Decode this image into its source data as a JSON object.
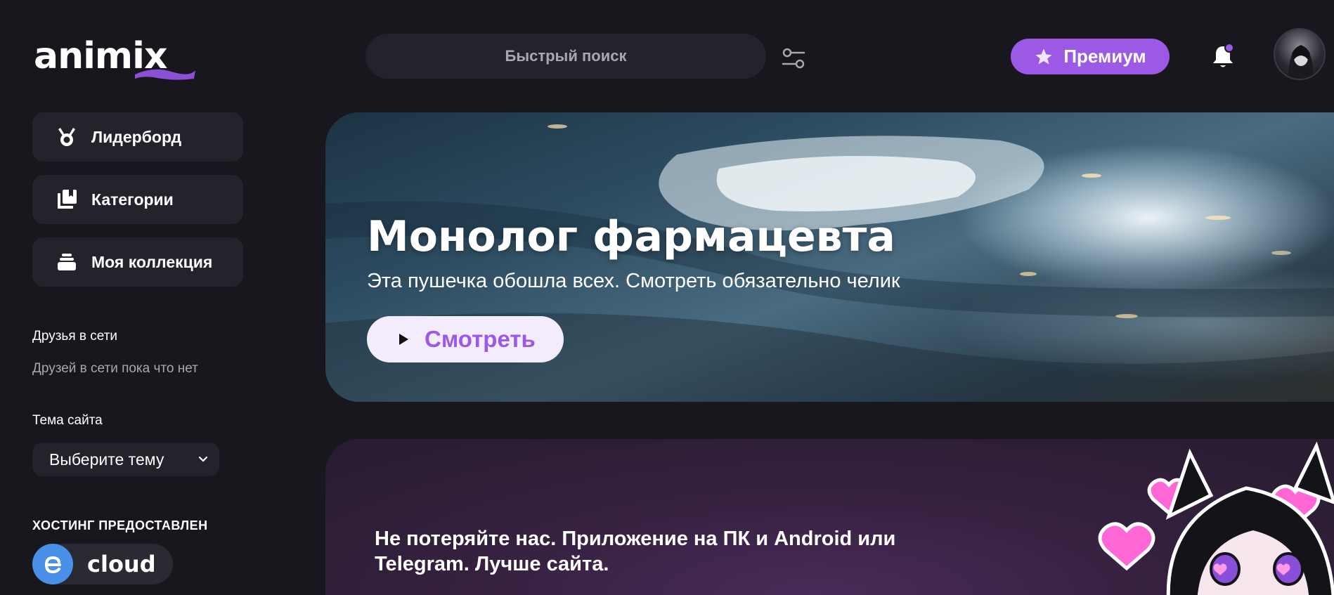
{
  "logo": {
    "text": "animix"
  },
  "header": {
    "search_placeholder": "Быстрый поиск",
    "premium_label": "Премиум"
  },
  "sidebar": {
    "items": [
      {
        "label": "Лидерборд",
        "icon": "medal-icon"
      },
      {
        "label": "Категории",
        "icon": "categories-icon"
      },
      {
        "label": "Моя коллекция",
        "icon": "collection-icon"
      }
    ],
    "friends_title": "Друзья в сети",
    "friends_empty": "Друзей в сети пока что нет",
    "theme_title": "Тема сайта",
    "theme_value": "Выберите тему",
    "hosting_title": "ХОСТИНГ ПРЕДОСТАВЛЕН",
    "hosting_label": "cloud"
  },
  "hero": {
    "title": "Монолог фармацевта",
    "subtitle": "Эта пушечка обошла всех. Смотреть обязательно челик",
    "watch_label": "Смотреть"
  },
  "promo": {
    "text": "Не потеряйте нас. Приложение на ПК и Android или Telegram. Лучше сайта."
  },
  "colors": {
    "background": "#17171d",
    "card": "#23232b",
    "accent": "#9b59e6",
    "watch_button_bg": "#f3ecfd"
  }
}
